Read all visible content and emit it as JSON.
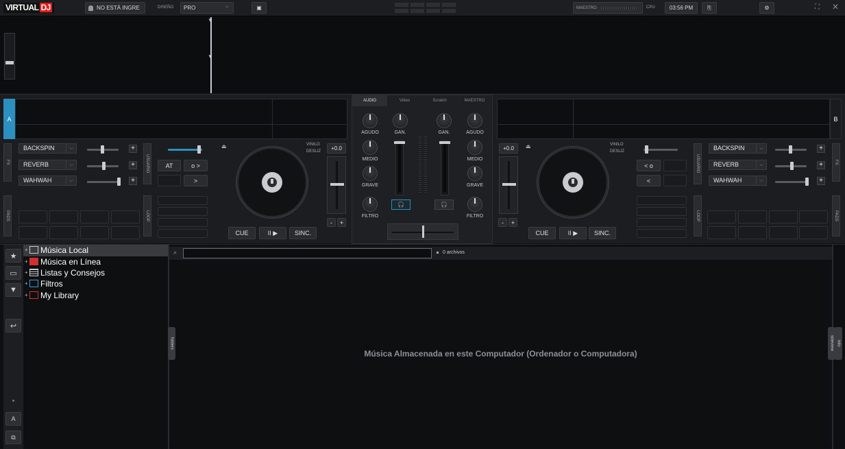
{
  "topbar": {
    "logo_main": "VIRTUAL",
    "logo_dj": "DJ",
    "login_label": "NO ESTÁ INGRE",
    "design_label": "DISEÑO",
    "design_value": "PRO",
    "master_label": "MAESTRO",
    "cpu_label": "CPU",
    "clock": "03:56 PM"
  },
  "deck_a": {
    "letter": "A",
    "effects": [
      "BACKSPIN",
      "REVERB",
      "WAHWAH"
    ],
    "fx_tab": "FX",
    "user_tab": "USUARIO",
    "pads_tab": "PADS",
    "loop_tab": "LOOP",
    "at_label": "AT",
    "loop_fwd": "o >",
    "loop_next": ">",
    "vinyl_label": "VINILO",
    "slip_label": "DESLIZ",
    "pitch_value": "+0.0",
    "minus": "-",
    "plus": "+",
    "cue": "CUE",
    "play": "II ▶",
    "sync": "SINC."
  },
  "deck_b": {
    "letter": "B",
    "effects": [
      "BACKSPIN",
      "REVERB",
      "WAHWAH"
    ],
    "fx_tab": "FX",
    "user_tab": "USUARIO",
    "pads_tab": "PADS",
    "loop_tab": "LOOP",
    "loop_back": "< o",
    "loop_prev": "<",
    "vinyl_label": "VINILO",
    "slip_label": "DESLIZ",
    "pitch_value": "+0.0",
    "minus": "-",
    "plus": "+",
    "cue": "CUE",
    "play": "II ▶",
    "sync": "SINC."
  },
  "mixer": {
    "tabs": [
      "AUDIO",
      "Video",
      "Scratch",
      "MAESTRO"
    ],
    "agudo": "AGUDO",
    "gan": "GAN.",
    "medio": "MEDIO",
    "grave": "GRAVE",
    "filtro": "FILTRO"
  },
  "browser": {
    "tree": [
      {
        "label": "Música Local",
        "icon": "computer-icon",
        "color": "#cccccc"
      },
      {
        "label": "Música en Línea",
        "icon": "online-music-icon",
        "color": "#d03030"
      },
      {
        "label": "Listas y Consejos",
        "icon": "list-icon",
        "color": "#cccccc"
      },
      {
        "label": "Filtros",
        "icon": "filter-icon",
        "color": "#3a9ad9"
      },
      {
        "label": "My Library",
        "icon": "library-icon",
        "color": "#d03030"
      }
    ],
    "search_value": "",
    "file_count": "0 archivos",
    "empty_message": "Música Almacenada en este Computador (Ordenador o Computadora)",
    "folders_tab": "folders",
    "info_tab": "info",
    "sideview_tab": "sideview"
  },
  "colors": {
    "accent_blue": "#2b8fbf",
    "logo_red": "#e01c1c"
  }
}
